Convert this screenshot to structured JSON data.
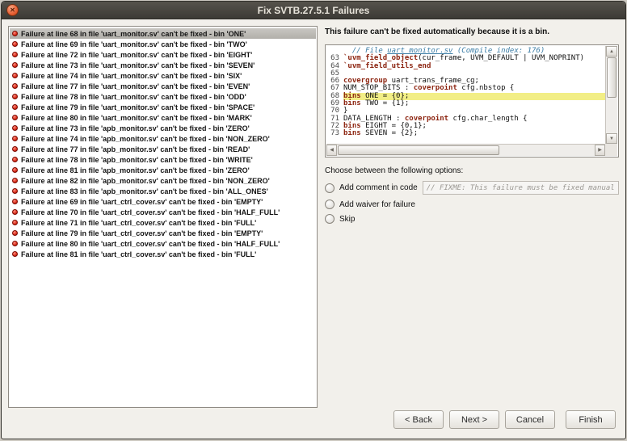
{
  "window": {
    "title": "Fix SVTB.27.5.1 Failures"
  },
  "selected_index": 0,
  "failures": [
    "Failure at line 68 in file 'uart_monitor.sv' can't be fixed - bin 'ONE'",
    "Failure at line 69 in file 'uart_monitor.sv' can't be fixed - bin 'TWO'",
    "Failure at line 72 in file 'uart_monitor.sv' can't be fixed - bin 'EIGHT'",
    "Failure at line 73 in file 'uart_monitor.sv' can't be fixed - bin 'SEVEN'",
    "Failure at line 74 in file 'uart_monitor.sv' can't be fixed - bin 'SIX'",
    "Failure at line 77 in file 'uart_monitor.sv' can't be fixed - bin 'EVEN'",
    "Failure at line 78 in file 'uart_monitor.sv' can't be fixed - bin 'ODD'",
    "Failure at line 79 in file 'uart_monitor.sv' can't be fixed - bin 'SPACE'",
    "Failure at line 80 in file 'uart_monitor.sv' can't be fixed - bin 'MARK'",
    "Failure at line 73 in file 'apb_monitor.sv' can't be fixed - bin 'ZERO'",
    "Failure at line 74 in file 'apb_monitor.sv' can't be fixed - bin 'NON_ZERO'",
    "Failure at line 77 in file 'apb_monitor.sv' can't be fixed - bin 'READ'",
    "Failure at line 78 in file 'apb_monitor.sv' can't be fixed - bin 'WRITE'",
    "Failure at line 81 in file 'apb_monitor.sv' can't be fixed - bin 'ZERO'",
    "Failure at line 82 in file 'apb_monitor.sv' can't be fixed - bin 'NON_ZERO'",
    "Failure at line 83 in file 'apb_monitor.sv' can't be fixed - bin 'ALL_ONES'",
    "Failure at line 69 in file 'uart_ctrl_cover.sv' can't be fixed - bin 'EMPTY'",
    "Failure at line 70 in file 'uart_ctrl_cover.sv' can't be fixed - bin 'HALF_FULL'",
    "Failure at line 71 in file 'uart_ctrl_cover.sv' can't be fixed - bin 'FULL'",
    "Failure at line 79 in file 'uart_ctrl_cover.sv' can't be fixed - bin 'EMPTY'",
    "Failure at line 80 in file 'uart_ctrl_cover.sv' can't be fixed - bin 'HALF_FULL'",
    "Failure at line 81 in file 'uart_ctrl_cover.sv' can't be fixed - bin 'FULL'"
  ],
  "detail": {
    "message": "This failure can't be fixed automatically because it is a bin.",
    "options_label": "Choose between the following options:"
  },
  "options": [
    {
      "label": "Add comment in code",
      "input_value": "// FIXME: This failure must be fixed manually"
    },
    {
      "label": "Add waiver for failure"
    },
    {
      "label": "Skip"
    }
  ],
  "code": {
    "lines": [
      {
        "n": "",
        "hl": false,
        "segs": [
          {
            "t": "  // File ",
            "c": "com"
          },
          {
            "t": "uart_monitor.sv",
            "c": "com",
            "u": true
          },
          {
            "t": " (Compile index: 176)",
            "c": "com"
          }
        ]
      },
      {
        "n": "63",
        "hl": false,
        "segs": [
          {
            "t": "`uvm_field_object",
            "c": "kw"
          },
          {
            "t": "(cur_frame, UVM_DEFAULT | UVM_NOPRINT)",
            "c": ""
          }
        ]
      },
      {
        "n": "64",
        "hl": false,
        "segs": [
          {
            "t": "`uvm_field_utils_end",
            "c": "kw"
          }
        ]
      },
      {
        "n": "65",
        "hl": false,
        "segs": []
      },
      {
        "n": "66",
        "hl": false,
        "segs": [
          {
            "t": "covergroup",
            "c": "kw"
          },
          {
            "t": " uart_trans_frame_cg;",
            "c": ""
          }
        ]
      },
      {
        "n": "67",
        "hl": false,
        "segs": [
          {
            "t": "NUM_STOP_BITS : ",
            "c": ""
          },
          {
            "t": "coverpoint",
            "c": "kw"
          },
          {
            "t": " cfg.nbstop {",
            "c": ""
          }
        ]
      },
      {
        "n": "68",
        "hl": true,
        "segs": [
          {
            "t": "bins",
            "c": "kw"
          },
          {
            "t": " ONE = {0};",
            "c": ""
          }
        ]
      },
      {
        "n": "69",
        "hl": false,
        "segs": [
          {
            "t": "bins",
            "c": "kw"
          },
          {
            "t": " TWO = {1};",
            "c": ""
          }
        ]
      },
      {
        "n": "70",
        "hl": false,
        "segs": [
          {
            "t": "}",
            "c": ""
          }
        ]
      },
      {
        "n": "71",
        "hl": false,
        "segs": [
          {
            "t": "DATA_LENGTH : ",
            "c": ""
          },
          {
            "t": "coverpoint",
            "c": "kw"
          },
          {
            "t": " cfg.char_length {",
            "c": ""
          }
        ]
      },
      {
        "n": "72",
        "hl": false,
        "segs": [
          {
            "t": "bins",
            "c": "kw"
          },
          {
            "t": " EIGHT = {0,1};",
            "c": ""
          }
        ]
      },
      {
        "n": "73",
        "hl": false,
        "segs": [
          {
            "t": "bins",
            "c": "kw"
          },
          {
            "t": " SEVEN = {2};",
            "c": ""
          }
        ]
      }
    ]
  },
  "buttons": {
    "back": "< Back",
    "next": "Next >",
    "cancel": "Cancel",
    "finish": "Finish"
  },
  "colors": {
    "titlebar": "#3c3a35",
    "close_button": "#e8653a",
    "failure_dot": "#da2c1a",
    "keyword": "#8c2410",
    "comment": "#3a7ca5",
    "highlight_line": "#f2ee86"
  }
}
